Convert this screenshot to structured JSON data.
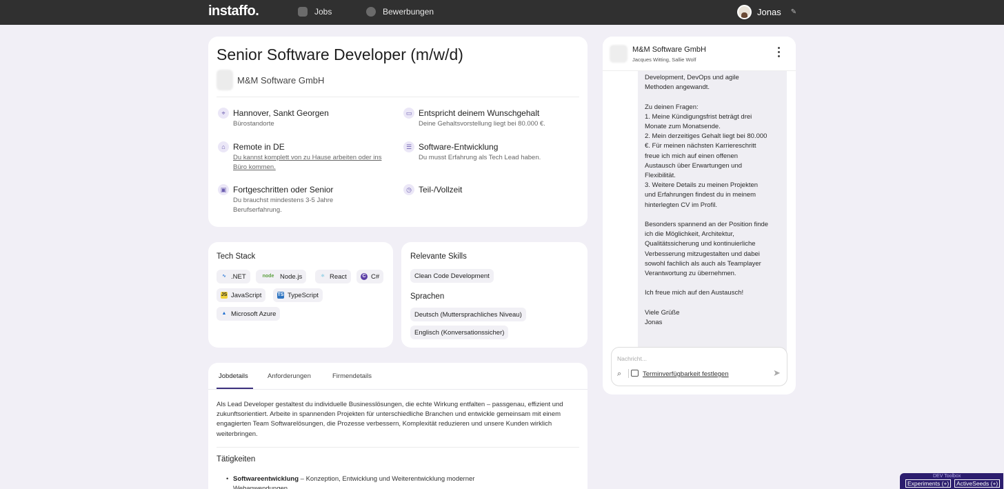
{
  "topbar": {
    "logo": "instaffo.",
    "nav": [
      {
        "label": "Jobs",
        "icon": "document-icon"
      },
      {
        "label": "Bewerbungen",
        "icon": "chat-dots-icon"
      }
    ],
    "user_name": "Jonas"
  },
  "job": {
    "title": "Senior Software Developer (m/w/d)",
    "company": "M&M Software GmbH",
    "features": [
      {
        "title": "Hannover, Sankt Georgen",
        "sub": "Bürostandorte",
        "icon": "location-pin-icon"
      },
      {
        "title": "Entspricht deinem Wunschgehalt",
        "sub": "Deine Gehaltsvorstellung liegt bei 80.000 €.",
        "icon": "money-icon"
      },
      {
        "title": "Remote in DE",
        "sub": "Du kannst komplett von zu Hause arbeiten oder ins Büro kommen.",
        "icon": "home-office-icon"
      },
      {
        "title": "Software-Entwicklung",
        "sub": "Du musst Erfahrung als Tech Lead haben.",
        "icon": "person-code-icon"
      },
      {
        "title": "Fortgeschritten oder Senior",
        "sub": "Du brauchst mindestens 3-5 Jahre Berufserfahrung.",
        "icon": "briefcase-icon"
      },
      {
        "title": "Teil-/Vollzeit",
        "sub": "",
        "icon": "clock-icon"
      }
    ]
  },
  "tech_stack": {
    "title": "Tech Stack",
    "items": [
      ".NET",
      "Node.js",
      "React",
      "C#",
      "JavaScript",
      "TypeScript",
      "Microsoft Azure"
    ]
  },
  "skills": {
    "title": "Relevante Skills",
    "items": [
      "Clean Code Development"
    ],
    "languages_title": "Sprachen",
    "languages": [
      "Deutsch (Muttersprachliches Niveau)",
      "Englisch (Konversationssicher)"
    ]
  },
  "details": {
    "tabs": [
      "Jobdetails",
      "Anforderungen",
      "Firmendetails"
    ],
    "description": "Als Lead Developer gestaltest du individuelle Businesslösungen, die echte Wirkung entfalten – passgenau, effizient und zukunftsorientiert. Arbeite in spannenden Projekten für unterschiedliche Branchen und entwickle gemeinsam mit einem engagierten Team Softwarelösungen, die Prozesse verbessern, Komplexität reduzieren und unsere Kunden wirklich weiterbringen.",
    "activities_title": "Tätigkeiten",
    "bullet_bold": "Softwareentwicklung",
    "bullet_text": " – Konzeption, Entwicklung und Weiterentwicklung moderner Webanwendungen"
  },
  "chat": {
    "company": "M&M Software GmbH",
    "members": "Jacques Witting, Sallie Wolf",
    "message": "Development, DevOps und agile\nMethoden angewandt.\n\nZu deinen Fragen:\n1. Meine Kündigungsfrist beträgt drei\nMonate zum Monatsende.\n2. Mein derzeitiges Gehalt liegt bei 80.000\n€. Für meinen nächsten Karriereschritt\nfreue ich mich auf einen offenen\nAustausch über Erwartungen und\nFlexibilität.\n3. Weitere Details zu meinen Projekten\nund Erfahrungen findest du in meinem\nhinterlegten CV im Profil.\n\nBesonders spannend an der Position finde\nich die Möglichkeit, Architektur,\nQualitätssicherung und kontinuierliche\nVerbesserung mitzugestalten und dabei\nsowohl fachlich als auch als Teamplayer\nVerantwortung zu übernehmen.\n\nIch freue mich auf den Austausch!\n\nViele Grüße\nJonas",
    "input_placeholder": "Nachricht...",
    "termin_label": "Terminverfügbarkeit festlegen"
  },
  "devbar": {
    "label": "DEV Toolbox",
    "buttons": [
      "Experiments (+)",
      "ActiveSeeds (+)"
    ]
  }
}
